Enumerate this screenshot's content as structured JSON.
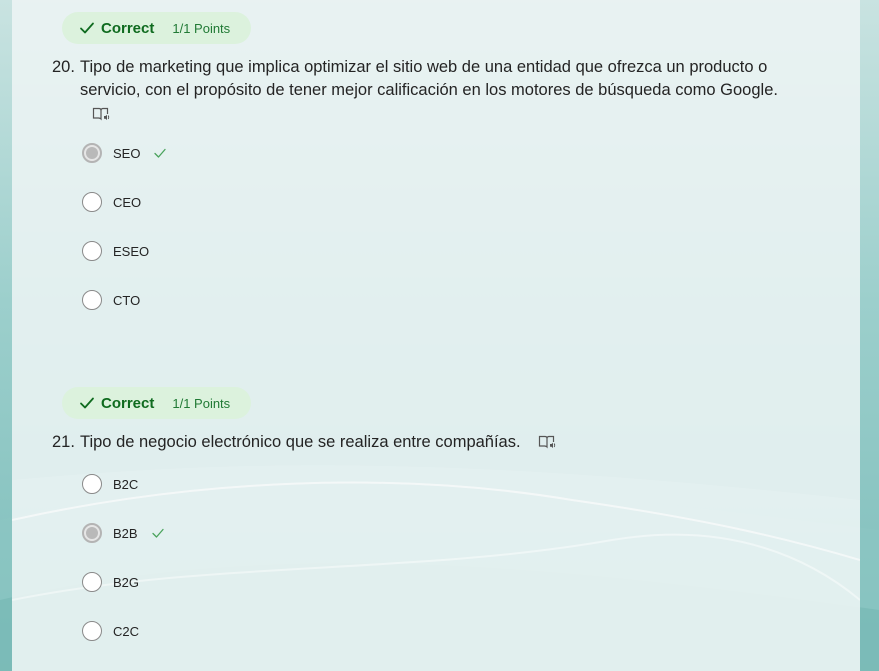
{
  "colors": {
    "badge_bg": "#dcf2dd",
    "correct_text": "#0f6b1f",
    "points_text": "#217a35",
    "check_mark": "#4aa35c",
    "background_teal": "#7dbdba"
  },
  "questions": [
    {
      "badge": {
        "status": "Correct",
        "points": "1/1 Points",
        "icon": "checkmark-icon"
      },
      "number": "20.",
      "text": "Tipo de marketing que implica optimizar el sitio web de una entidad que ofrezca un producto o servicio, con el propósito de tener mejor calificación en los motores de búsqueda como Google.",
      "reader_icon": "immersive-reader-icon",
      "options": [
        {
          "label": "SEO",
          "selected": true,
          "correct": true
        },
        {
          "label": "CEO",
          "selected": false,
          "correct": false
        },
        {
          "label": "ESEO",
          "selected": false,
          "correct": false
        },
        {
          "label": "CTO",
          "selected": false,
          "correct": false
        }
      ]
    },
    {
      "badge": {
        "status": "Correct",
        "points": "1/1 Points",
        "icon": "checkmark-icon"
      },
      "number": "21.",
      "text": "Tipo de negocio electrónico que se realiza entre compañías.",
      "reader_icon": "immersive-reader-icon",
      "options": [
        {
          "label": "B2C",
          "selected": false,
          "correct": false
        },
        {
          "label": "B2B",
          "selected": true,
          "correct": true
        },
        {
          "label": "B2G",
          "selected": false,
          "correct": false
        },
        {
          "label": "C2C",
          "selected": false,
          "correct": false
        }
      ]
    }
  ]
}
